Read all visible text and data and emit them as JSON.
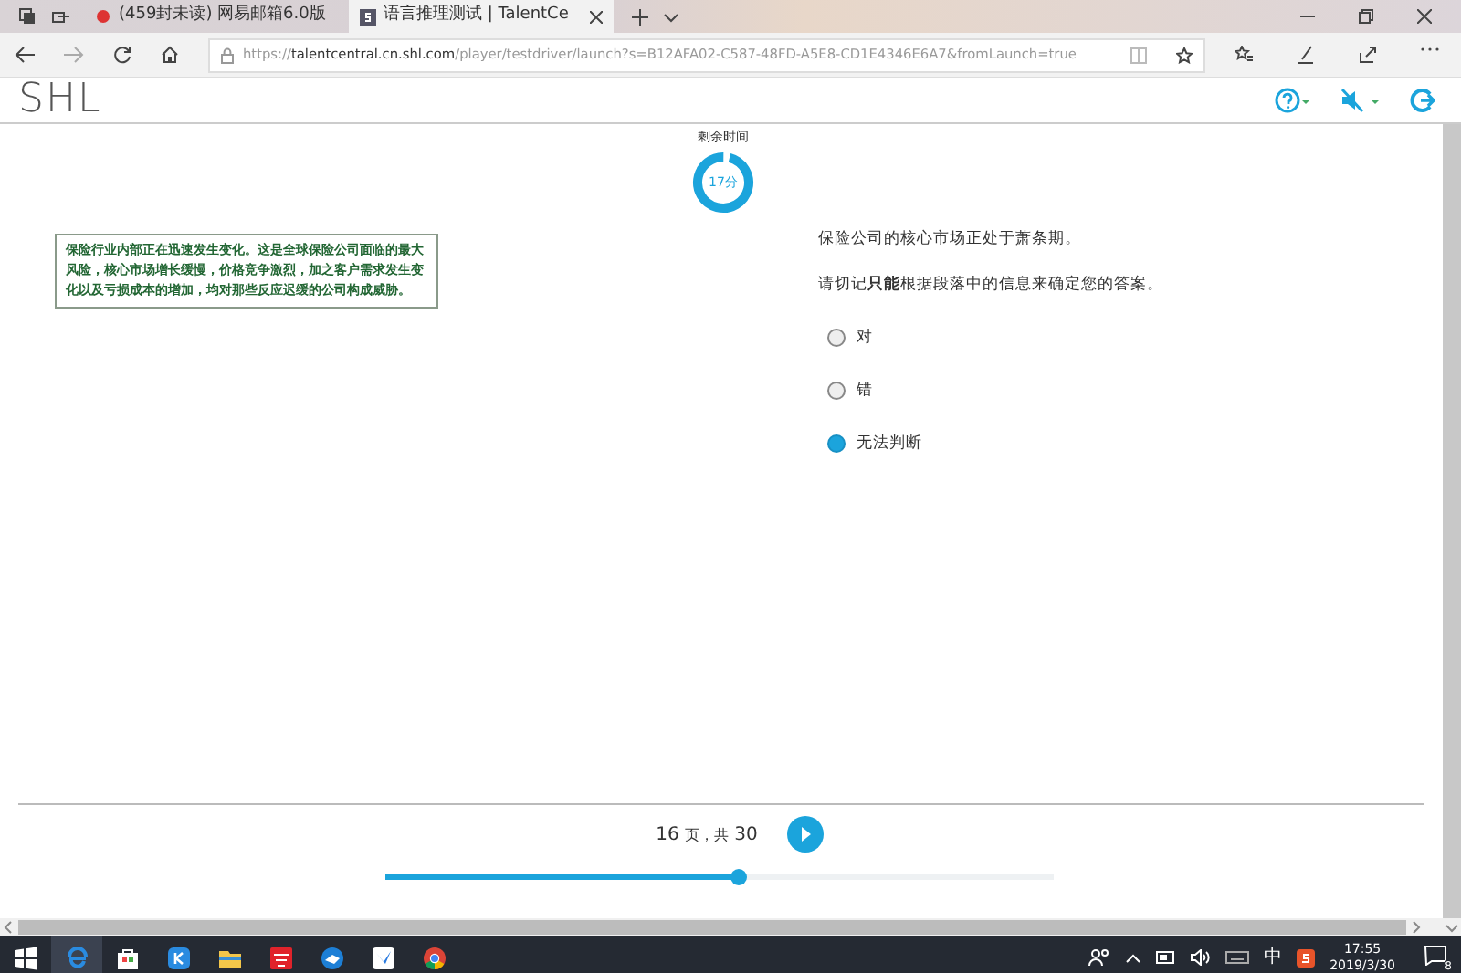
{
  "browser": {
    "tabs": [
      {
        "title": "(459封未读) 网易邮箱6.0版",
        "selected": false
      },
      {
        "title": "语言推理测试 | TalentCe",
        "selected": true
      }
    ],
    "url": {
      "host": "talentcentral.cn.shl.com",
      "rest": "/player/testdriver/launch?s=B12AFA02-C587-48FD-A5E8-CD1E4346E6A7&fromLaunch=true",
      "scheme": "https://"
    }
  },
  "header": {
    "logo": "SHL"
  },
  "timer": {
    "label": "剩余时间",
    "value": "17分"
  },
  "passage": "保险行业内部正在迅速发生变化。这是全球保险公司面临的最大风险，核心市场增长缓慢，价格竞争激烈，加之客户需求发生变化以及亏损成本的增加，均对那些反应迟缓的公司构成威胁。",
  "question": {
    "statement": "保险公司的核心市场正处于萧条期。",
    "instruction": "请切记**只能**根据段落中的信息来确定您的答案。",
    "options": [
      {
        "label": "对",
        "selected": false
      },
      {
        "label": "错",
        "selected": false
      },
      {
        "label": "无法判断",
        "selected": true
      }
    ]
  },
  "footer": {
    "page": "16",
    "page_unit": "页，共",
    "total": "30",
    "level": 0.53
  },
  "taskbar": {
    "time": "17:55",
    "date": "2019/3/30",
    "ime": "中",
    "notifications": "8"
  }
}
